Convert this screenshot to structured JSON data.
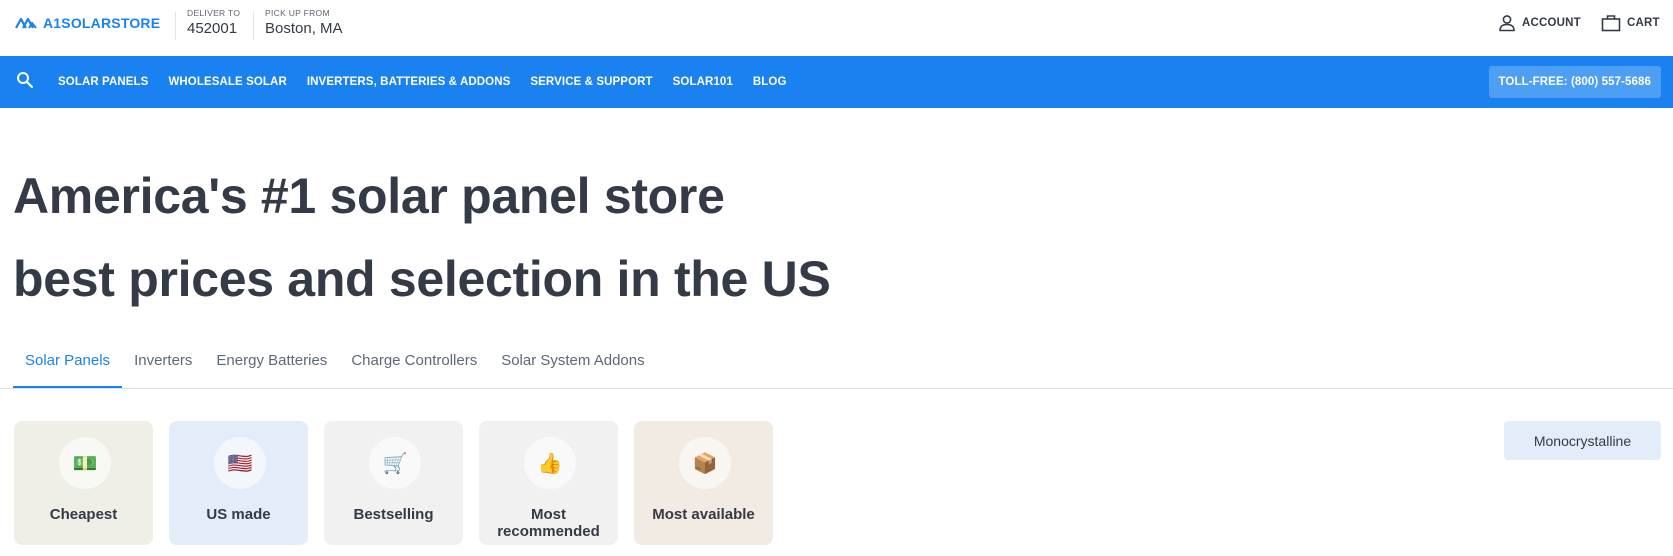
{
  "header": {
    "logo_text": "A1SOLARSTORE",
    "deliver": {
      "label": "DELIVER TO",
      "value": "452001"
    },
    "pickup": {
      "label": "PICK UP FROM",
      "value": "Boston, MA"
    },
    "account_label": "ACCOUNT",
    "cart_label": "CART"
  },
  "nav": {
    "items": [
      "SOLAR PANELS",
      "WHOLESALE SOLAR",
      "INVERTERS, BATTERIES & ADDONS",
      "SERVICE & SUPPORT",
      "SOLAR101",
      "BLOG"
    ],
    "tollfree": "TOLL-FREE: (800) 557-5686"
  },
  "hero": {
    "line1": "America's #1 solar panel store",
    "line2": "best prices and selection in the US"
  },
  "tabs": [
    {
      "label": "Solar Panels",
      "active": true
    },
    {
      "label": "Inverters",
      "active": false
    },
    {
      "label": "Energy Batteries",
      "active": false
    },
    {
      "label": "Charge Controllers",
      "active": false
    },
    {
      "label": "Solar System Addons",
      "active": false
    }
  ],
  "filters": [
    {
      "label": "Cheapest",
      "icon": "money-icon",
      "glyph": "💵",
      "bg": "#efefe8"
    },
    {
      "label": "US made",
      "icon": "us-flag-icon",
      "glyph": "🇺🇸",
      "bg": "#e3edf9"
    },
    {
      "label": "Bestselling",
      "icon": "cart-icon",
      "glyph": "🛒",
      "bg": "#f1f1f1"
    },
    {
      "label": "Most recommended",
      "icon": "thumbs-up-icon",
      "glyph": "👍",
      "bg": "#f1f1f1"
    },
    {
      "label": "Most available",
      "icon": "package-icon",
      "glyph": "📦",
      "bg": "#f2ebe3"
    }
  ],
  "type_chip": "Monocrystalline",
  "colors": {
    "brand": "#1a82f0",
    "text": "#343a46"
  }
}
